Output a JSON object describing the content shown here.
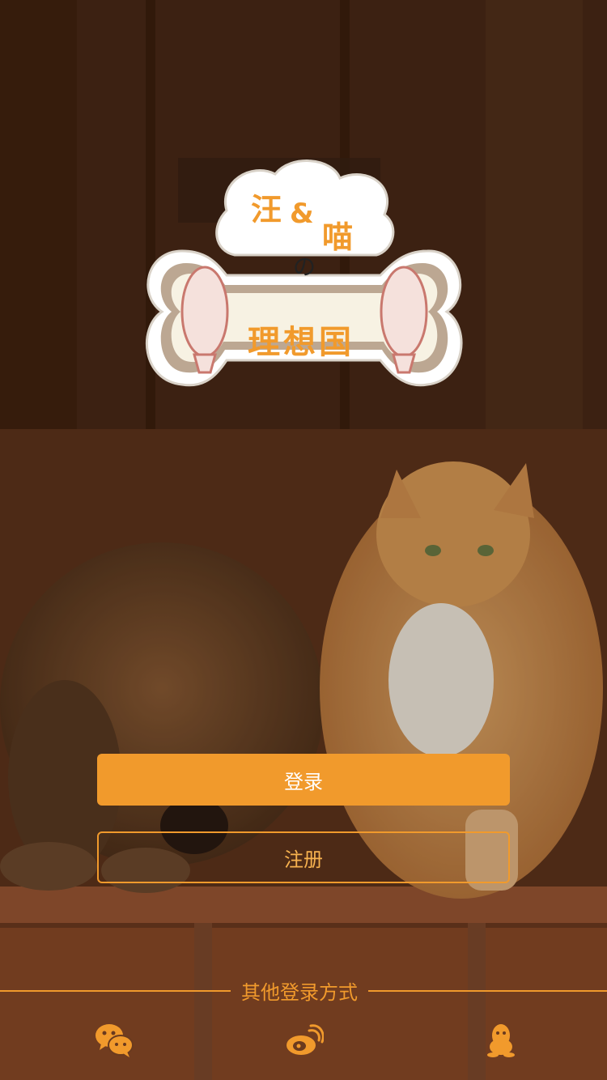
{
  "logo": {
    "line1_wang": "汪",
    "line1_amp": "&",
    "line1_miao": "喵",
    "connector": "の",
    "line2": "理想国"
  },
  "buttons": {
    "login_label": "登录",
    "register_label": "注册"
  },
  "other_login": {
    "label": "其他登录方式",
    "icons": [
      "wechat-icon",
      "weibo-icon",
      "qq-icon"
    ]
  },
  "colors": {
    "accent": "#f19a2c",
    "background": "#5a3219",
    "logo_bg": "#ffffff"
  }
}
